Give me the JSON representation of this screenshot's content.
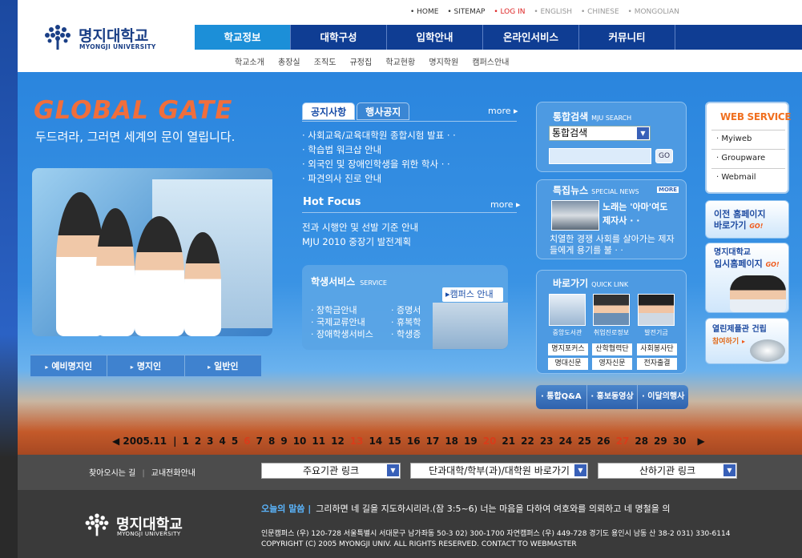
{
  "header": {
    "logo_ko": "명지대학교",
    "logo_en": "MYONGJI UNIVERSITY",
    "toplinks": [
      {
        "label": "• HOME"
      },
      {
        "label": "• SITEMAP"
      },
      {
        "label": "• LOG IN"
      },
      {
        "label": "• ENGLISH"
      },
      {
        "label": "• CHINESE"
      },
      {
        "label": "• MONGOLIAN"
      }
    ],
    "nav": [
      "학교정보",
      "대학구성",
      "입학안내",
      "온라인서비스",
      "커뮤니티"
    ],
    "subnav": [
      "학교소개",
      "총장실",
      "조직도",
      "규정집",
      "학교현황",
      "명지학원",
      "캠퍼스안내"
    ]
  },
  "hero": {
    "title": "GLOBAL GATE",
    "subtitle": "두드려라, 그러면 세계의 문이 열립니다.",
    "who": [
      "예비명지인",
      "명지인",
      "일반인"
    ]
  },
  "notice": {
    "tab_on": "공지사항",
    "tab_off": "행사공지",
    "more": "more ▸",
    "items": [
      "· 사회교육/교육대학원 종합시험 발표 · ·",
      "· 학습법 워크샵 안내",
      "· 외국인 및 장애인학생을 위한 학사 · ·",
      "· 파견의사 진로 안내"
    ]
  },
  "hotfocus": {
    "title": "Hot Focus",
    "more": "more ▸",
    "items": [
      "전과 시행안 및 선발 기준 안내",
      "MJU 2010 중장기 발전계획"
    ]
  },
  "service": {
    "title": "학생서비스",
    "title_en": "SERVICE",
    "campus": "▸캠퍼스 안내",
    "left": [
      "· 장학금안내",
      "· 국제교류안내",
      "· 장애학생서비스"
    ],
    "right": [
      "· 증명서",
      "· 휴복학",
      "· 학생증"
    ]
  },
  "search": {
    "title": "통합검색",
    "title_en": "MJU SEARCH",
    "select": "통합검색",
    "go": "GO"
  },
  "news": {
    "title": "특집뉴스",
    "title_en": "SPECIAL NEWS",
    "more": "MORE",
    "head": "노래는 '아마'여도 제자사 · ·",
    "body": "치열한 경쟁 사회를 살아가는 제자들에게 용기를 불 · ·"
  },
  "quick": {
    "title": "바로가기",
    "title_en": "QUICK LINK",
    "captions": [
      "중앙도서관",
      "취업진로정보",
      "발전기금"
    ],
    "buttons": [
      "명지포커스",
      "산학협력단",
      "사회봉사단",
      "명대신문",
      "영자신문",
      "전자출결"
    ]
  },
  "qbar": [
    "· 통합Q&A",
    "· 홍보동영상",
    "· 이달의행사"
  ],
  "webservice": {
    "title": "WEB SERVICE",
    "items": [
      "· Myiweb",
      "· Groupware",
      "· Webmail"
    ]
  },
  "banners": [
    {
      "line1": "이전 홈페이지",
      "line2": "바로가기",
      "tag": "GO!"
    },
    {
      "line1": "명지대학교",
      "line2": "입시홈페이지",
      "tag": "GO!"
    },
    {
      "line1": "열린제플관 건립",
      "line2": "참여하기",
      "tag": "▸"
    }
  ],
  "calendar": {
    "year": "◀ 2005.11",
    "sep": "|",
    "days": [
      "1",
      "2",
      "3",
      "4",
      "5",
      "6",
      "7",
      "8",
      "9",
      "10",
      "11",
      "12",
      "13",
      "14",
      "15",
      "16",
      "17",
      "18",
      "19",
      "20",
      "21",
      "22",
      "23",
      "24",
      "25",
      "26",
      "27",
      "28",
      "29",
      "30"
    ],
    "red_days": [
      "6",
      "13",
      "20",
      "27"
    ],
    "next": "▶"
  },
  "bottom": {
    "find": "찾아오시는 길",
    "phone": "교내전화안내",
    "selects": [
      "주요기관 링크",
      "단과대학/학부(과)/대학원 바로가기",
      "산하기관 링크"
    ]
  },
  "footer": {
    "logo_ko": "명지대학교",
    "logo_en": "MYONGJI UNIVERSITY",
    "saying_label": "오늘의 말씀 |",
    "saying": "그리하면 네 길을 지도하시리라.(잠 3:5~6)   너는 마음을 다하여 여호와를 의뢰하고 네 명철을 의",
    "addr1": "인문캠퍼스 (우) 120-728 서울특별시 서대문구 남가좌동 50-3  02) 300-1700    자연캠퍼스 (우) 449-728 경기도 용인시 남동 산 38-2   031) 330-6114",
    "addr2": "COPYRIGHT (C) 2005  MYONGJI UNIV. ALL RIGHTS RESERVED.  CONTACT TO WEBMASTER"
  },
  "colors": {
    "nav": "#0f3d93",
    "nav_active": "#1c8fd8",
    "accent": "#f06e3c",
    "hero": "#2a85de",
    "footer": "#3a3a3a"
  }
}
